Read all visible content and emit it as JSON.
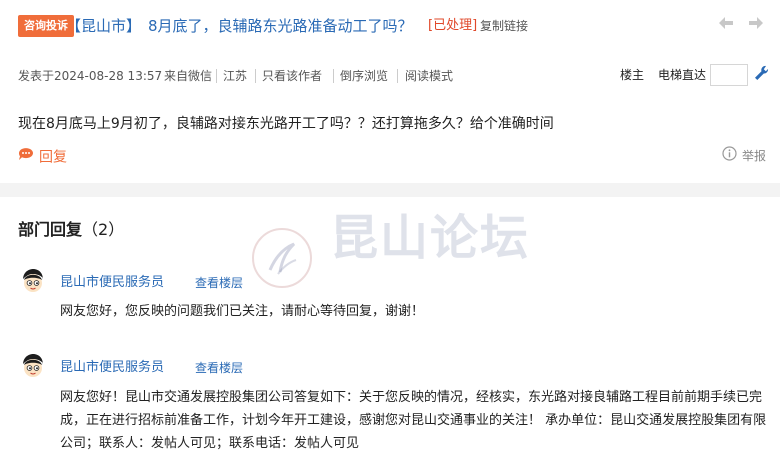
{
  "header": {
    "badge": "咨询投诉",
    "region": "【昆山市】",
    "title": "8月底了，良辅路东光路准备动工了吗？",
    "status": "[已处理]",
    "copy_link": "复制链接",
    "prev_icon": "arrow-left-icon",
    "next_icon": "arrow-right-icon"
  },
  "meta": {
    "posted": "发表于2024-08-28 13:57",
    "source": "来自微信",
    "location": "江苏",
    "only_author": "只看该作者",
    "reverse": "倒序浏览",
    "read_mode": "阅读模式",
    "floor_owner": "楼主",
    "jump_label": "电梯直达",
    "jump_value": ""
  },
  "post": {
    "content": "现在8月底马上9月初了，良辅路对接东光路开工了吗？？还打算拖多久？给个准确时间",
    "reply_label": "回复",
    "report_label": "举报"
  },
  "replies": {
    "title": "部门回复",
    "count": "（2）",
    "items": [
      {
        "poster": "昆山市便民服务员",
        "view_floor": "查看楼层",
        "text": "网友您好，您反映的问题我们已关注，请耐心等待回复，谢谢！"
      },
      {
        "poster": "昆山市便民服务员",
        "view_floor": "查看楼层",
        "text": "网友您好！昆山市交通发展控股集团公司答复如下：关于您反映的情况，经核实，东光路对接良辅路工程目前前期手续已完成，正在进行招标前准备工作，计划今年开工建设，感谢您对昆山交通事业的关注！ 承办单位：昆山交通发展控股集团有限公司；联系人：发帖人可见；联系电话：发帖人可见"
      }
    ]
  },
  "watermark": {
    "text": "昆山论坛"
  },
  "colors": {
    "badge": "#f06d3a",
    "link": "#2a6ab5",
    "status": "#e0482a",
    "reply_accent": "#f06d3a",
    "divider": "#f3f3f3"
  }
}
